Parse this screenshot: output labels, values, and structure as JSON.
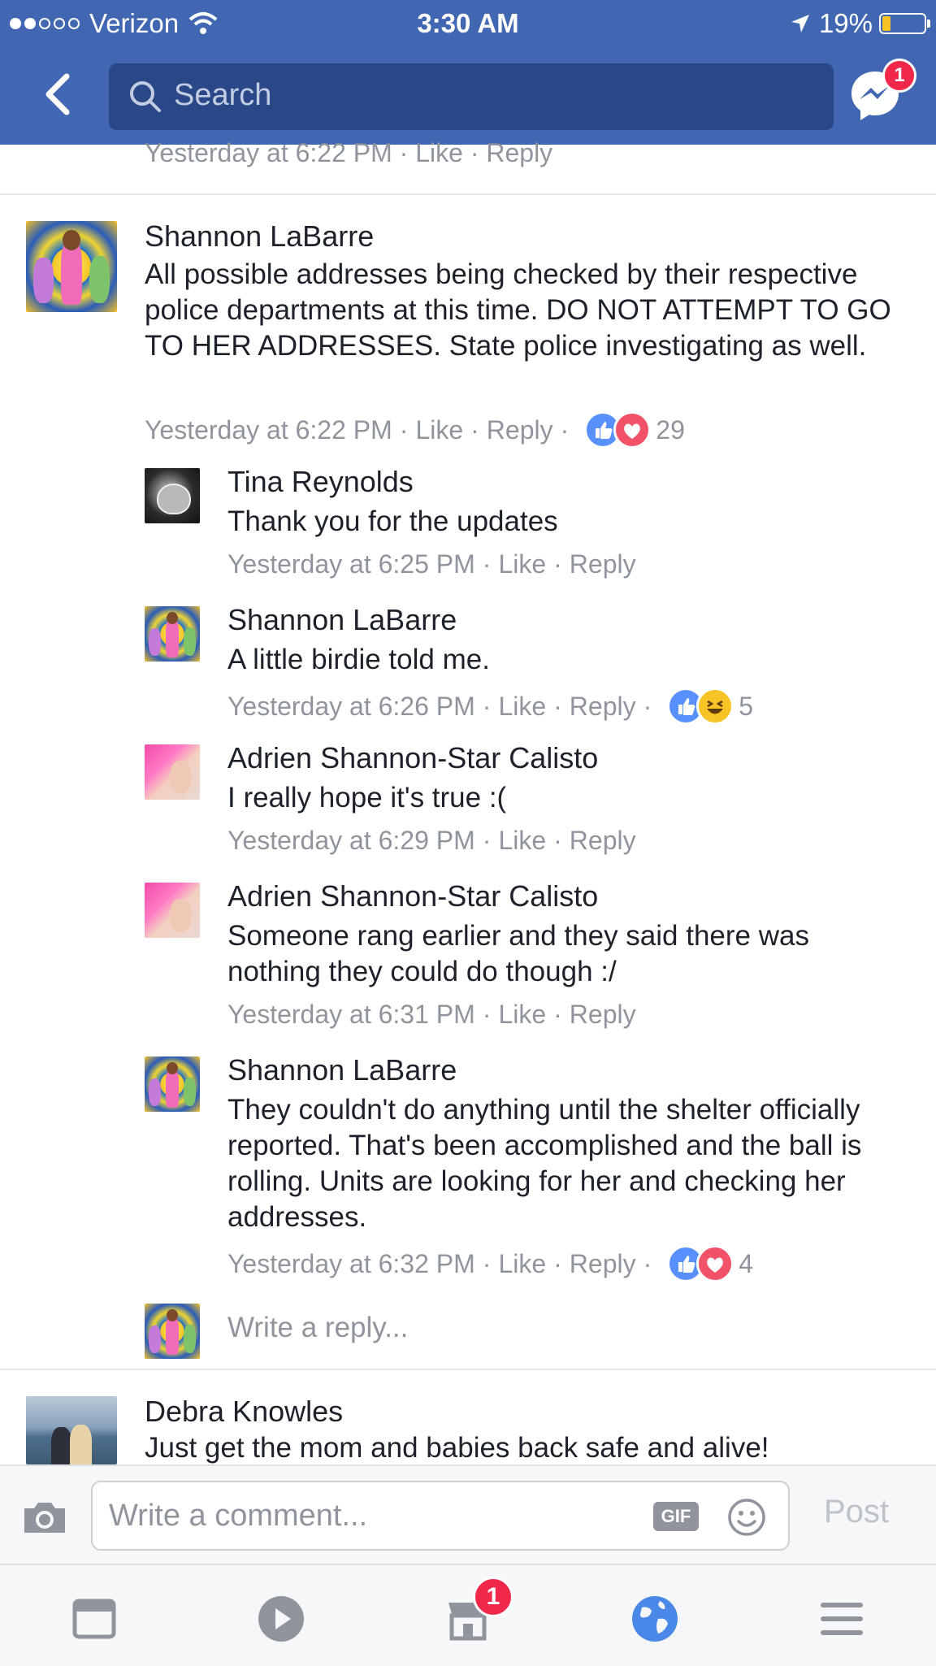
{
  "status_bar": {
    "carrier": "Verizon",
    "time": "3:30 AM",
    "battery": "19%"
  },
  "nav": {
    "search_placeholder": "Search",
    "messenger_badge": "1"
  },
  "clipped_meta": "Yesterday at 6:22 PM · Like · Reply",
  "comments": [
    {
      "name": "Shannon LaBarre",
      "text": "All possible addresses being checked by their respective police departments at this time. DO NOT ATTEMPT TO GO TO HER ADDRESSES. State police investigating as well.",
      "time": "Yesterday at 6:22 PM",
      "like": "Like",
      "reply": "Reply",
      "reactions": [
        "like",
        "love"
      ],
      "reaction_count": "29"
    },
    {
      "name": "Tina Reynolds",
      "text": "Thank you for the updates",
      "time": "Yesterday at 6:25 PM",
      "like": "Like",
      "reply": "Reply"
    },
    {
      "name": "Shannon LaBarre",
      "text": "A little birdie told me.",
      "time": "Yesterday at 6:26 PM",
      "like": "Like",
      "reply": "Reply",
      "reactions": [
        "like",
        "haha"
      ],
      "reaction_count": "5"
    },
    {
      "name": "Adrien Shannon-Star Calisto",
      "text": "I really hope it's true :(",
      "time": "Yesterday at 6:29 PM",
      "like": "Like",
      "reply": "Reply"
    },
    {
      "name": "Adrien Shannon-Star Calisto",
      "text": "Someone rang earlier and they said there was nothing they could do though :/",
      "time": "Yesterday at 6:31 PM",
      "like": "Like",
      "reply": "Reply"
    },
    {
      "name": "Shannon LaBarre",
      "text": "They couldn't do anything until the shelter officially reported. That's been accomplished and the ball is rolling. Units are looking for her and checking her addresses.",
      "time": "Yesterday at 6:32 PM",
      "like": "Like",
      "reply": "Reply",
      "reactions": [
        "like",
        "love"
      ],
      "reaction_count": "4"
    },
    {
      "name": "Debra Knowles",
      "text": "Just get the mom and babies back safe and alive!"
    }
  ],
  "write_reply_placeholder": "Write a reply...",
  "composer": {
    "placeholder": "Write a comment...",
    "gif": "GIF",
    "post": "Post"
  },
  "tabbar": {
    "marketplace_badge": "1"
  },
  "colors": {
    "brand": "#4267b2",
    "like": "#5890ff",
    "love": "#f25268",
    "haha": "#f7c325",
    "badge": "#f02849"
  }
}
